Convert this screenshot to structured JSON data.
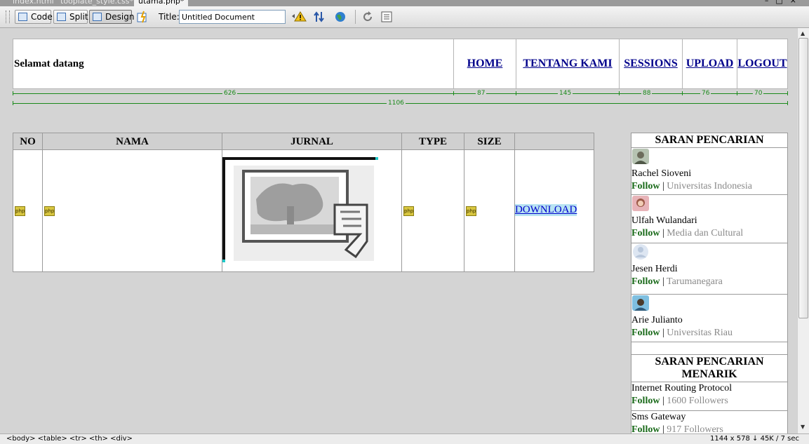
{
  "doc_tabs": [
    {
      "label": "index.html"
    },
    {
      "label": "tooplate_style.css*"
    },
    {
      "label": "utama.php*"
    }
  ],
  "toolbar": {
    "code_label": "Code",
    "split_label": "Split",
    "design_label": "Design",
    "title_label": "Title:",
    "title_value": "Untitled Document"
  },
  "header": {
    "welcome": "Selamat datang",
    "nav": [
      "HOME",
      "TENTANG KAMI",
      "SESSIONS",
      "UPLOAD",
      "LOGOUT"
    ]
  },
  "rulers": {
    "columns": [
      "626",
      "87",
      "145",
      "88",
      "76",
      "70"
    ],
    "total": "1106"
  },
  "table": {
    "headers": [
      "NO",
      "NAMA",
      "JURNAL",
      "TYPE",
      "SIZE",
      ""
    ],
    "php_badge": "php",
    "download": "DOWNLOAD"
  },
  "saran": {
    "title": "SARAN PENCARIAN",
    "follow": "Follow",
    "people": [
      {
        "name": "Rachel Sioveni",
        "org": "Universitas Indonesia"
      },
      {
        "name": "Ulfah Wulandari",
        "org": "Media dan Cultural"
      },
      {
        "name": "Jesen Herdi",
        "org": "Tarumanegara"
      },
      {
        "name": "Arie Julianto",
        "org": "Universitas Riau"
      }
    ]
  },
  "menarik": {
    "title": "SARAN PENCARIAN MENARIK",
    "items": [
      {
        "name": "Internet Routing Protocol",
        "followers": "1600 Followers"
      },
      {
        "name": "Sms Gateway",
        "followers": "917 Followers"
      }
    ]
  },
  "status": {
    "tags": "<body> <table> <tr> <th> <div>",
    "info": "1144 x 578 ↓ 45K / 7 sec"
  },
  "colors": {
    "follow": "#1a6a1a",
    "link": "#00008b",
    "ruler": "#1a8a1a"
  }
}
